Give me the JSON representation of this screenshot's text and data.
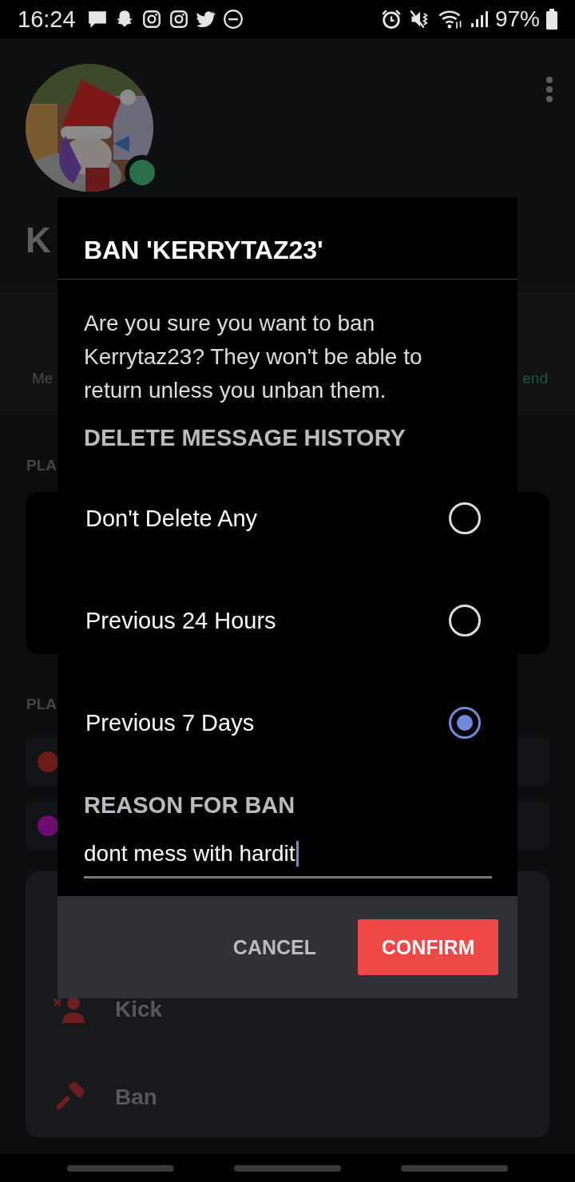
{
  "status_bar": {
    "time": "16:24",
    "battery": "97%"
  },
  "profile": {
    "name": "K",
    "online": true,
    "tabs": [
      {
        "label": "Me",
        "kind": "plain"
      },
      {
        "label": "end",
        "kind": "accent"
      }
    ],
    "sections": [
      {
        "heading": "PLA",
        "kind": "card"
      },
      {
        "heading": "PLA",
        "kind": "list",
        "items": [
          {
            "color": "#6e1a1a"
          },
          {
            "color": "#6f0a6f"
          }
        ]
      }
    ],
    "actions": [
      {
        "label": "Kick",
        "kind": "kick"
      },
      {
        "label": "Ban",
        "kind": "ban"
      }
    ]
  },
  "dialog": {
    "title": "BAN 'KERRYTAZ23'",
    "message": "Are you sure you want to ban Kerrytaz23? They won't be able to return unless you unban them.",
    "history_heading": "DELETE MESSAGE HISTORY",
    "options": [
      {
        "label": "Don't Delete Any",
        "selected": false
      },
      {
        "label": "Previous 24 Hours",
        "selected": false
      },
      {
        "label": "Previous 7 Days",
        "selected": true
      }
    ],
    "reason": {
      "label": "REASON FOR BAN",
      "value": "dont mess with hardit"
    },
    "buttons": [
      {
        "label": "CANCEL",
        "kind": "secondary"
      },
      {
        "label": "CONFIRM",
        "kind": "primary"
      }
    ]
  }
}
